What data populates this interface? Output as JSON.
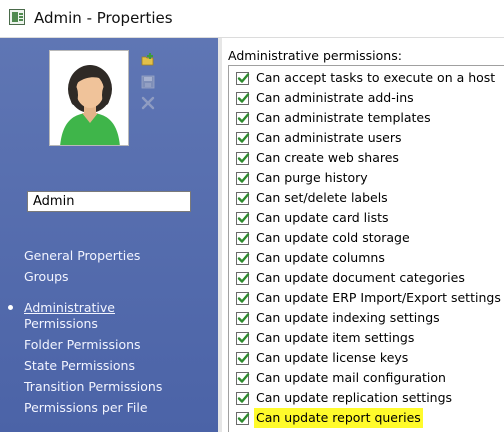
{
  "window": {
    "title": "Admin - Properties"
  },
  "user": {
    "name": "Admin"
  },
  "nav": {
    "items": [
      {
        "label": "General Properties",
        "active": false
      },
      {
        "label": "Groups",
        "active": false
      },
      {
        "label": "Administrative",
        "label2": "Permissions",
        "active": true
      },
      {
        "label": "Folder Permissions",
        "active": false
      },
      {
        "label": "State Permissions",
        "active": false
      },
      {
        "label": "Transition Permissions",
        "active": false
      },
      {
        "label": "Permissions per File",
        "active": false
      }
    ]
  },
  "permissions": {
    "header": "Administrative permissions:",
    "items": [
      {
        "label": "Can accept tasks to execute on a host",
        "checked": true
      },
      {
        "label": "Can administrate add-ins",
        "checked": true
      },
      {
        "label": "Can administrate templates",
        "checked": true
      },
      {
        "label": "Can administrate users",
        "checked": true
      },
      {
        "label": "Can create web shares",
        "checked": true
      },
      {
        "label": "Can purge history",
        "checked": true
      },
      {
        "label": "Can set/delete labels",
        "checked": true
      },
      {
        "label": "Can update card lists",
        "checked": true
      },
      {
        "label": "Can update cold storage",
        "checked": true
      },
      {
        "label": "Can update columns",
        "checked": true
      },
      {
        "label": "Can update document categories",
        "checked": true
      },
      {
        "label": "Can update ERP Import/Export settings",
        "checked": true
      },
      {
        "label": "Can update indexing settings",
        "checked": true
      },
      {
        "label": "Can update item settings",
        "checked": true
      },
      {
        "label": "Can update license keys",
        "checked": true
      },
      {
        "label": "Can update mail configuration",
        "checked": true
      },
      {
        "label": "Can update replication settings",
        "checked": true
      },
      {
        "label": "Can update report queries",
        "checked": true,
        "highlighted": true
      }
    ]
  },
  "colors": {
    "panel": "#5f76b4",
    "highlight": "#fffb2b",
    "check": "#2e8b2e"
  },
  "icons": [
    "app-icon",
    "user-avatar-icon",
    "add-folder-icon",
    "save-icon",
    "delete-icon",
    "checkbox-checked-icon"
  ]
}
